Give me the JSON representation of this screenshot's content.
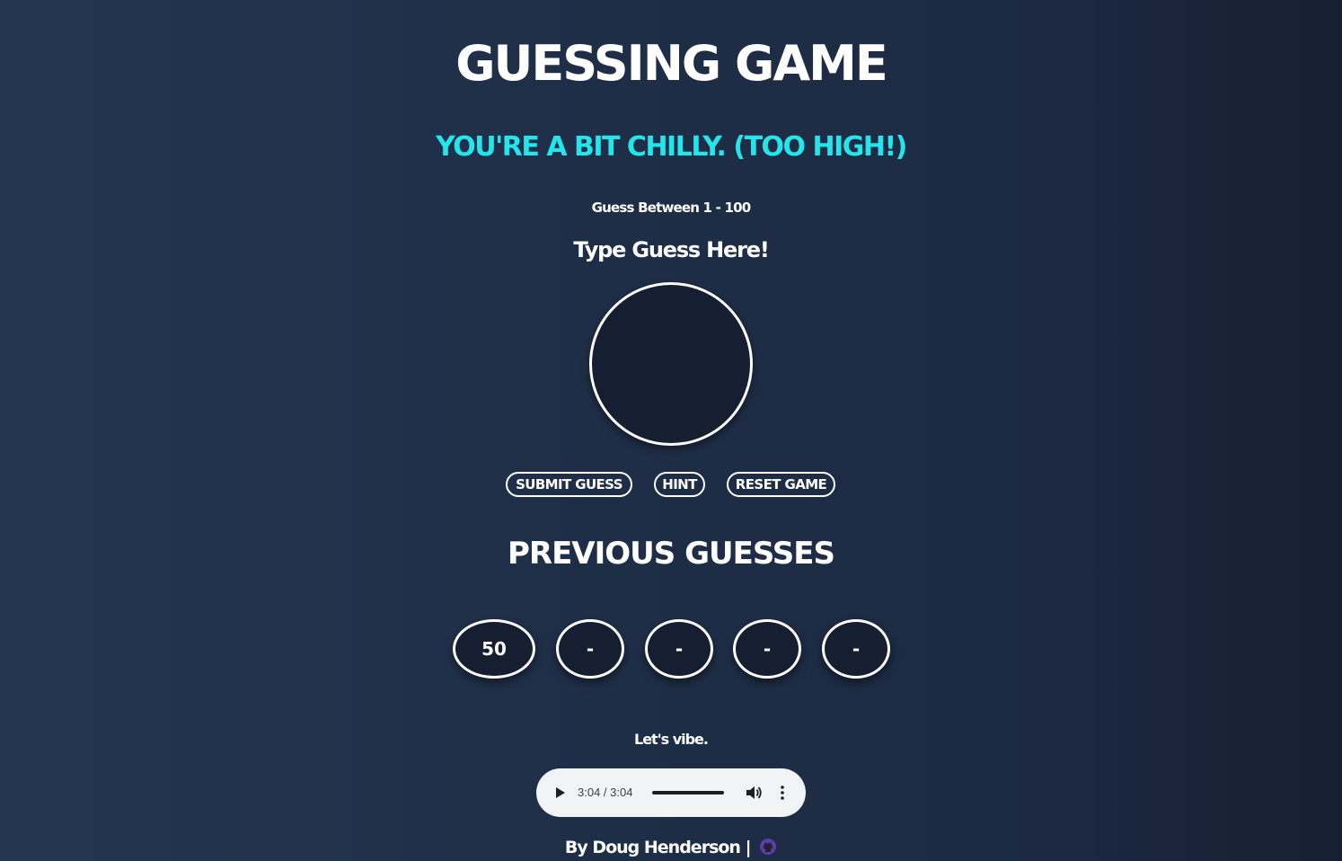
{
  "game": {
    "title": "GUESSING GAME",
    "status": "YOU'RE A BIT CHILLY. (TOO HIGH!)",
    "range": "Guess Between 1 - 100",
    "input_label": "Type Guess Here!",
    "input_value": ""
  },
  "buttons": {
    "submit": "SUBMIT GUESS",
    "hint": "HINT",
    "reset": "RESET GAME"
  },
  "previous": {
    "title": "PREVIOUS GUESSES",
    "guesses": [
      "50",
      "-",
      "-",
      "-",
      "-"
    ]
  },
  "music": {
    "label": "Let's vibe.",
    "time": "3:04 / 3:04",
    "progress": 1.0
  },
  "footer": {
    "author": "By Doug Henderson |",
    "icon": "github-icon",
    "icon_color": "#5a3fa0"
  },
  "colors": {
    "status": "#22e6ec",
    "background": "#1f2e47"
  }
}
